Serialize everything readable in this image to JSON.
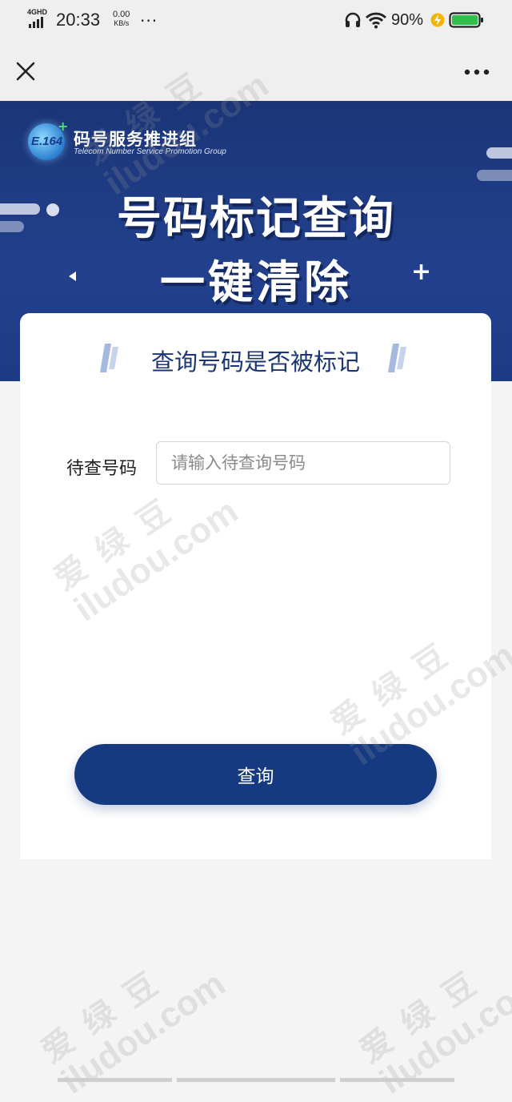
{
  "status_bar": {
    "network": "4GHD",
    "time": "20:33",
    "speed_value": "0.00",
    "speed_unit": "KB/s",
    "more": "···",
    "battery_percent": "90%",
    "battery_color": "#2fbf4a",
    "charging_color": "#f5b400"
  },
  "nav": {
    "close_icon": "close-icon",
    "more_icon": "more-horizontal-icon"
  },
  "banner": {
    "logo_badge": "E.164",
    "org_name": "码号服务推进组",
    "org_name_en": "Telecom Number Service  Promotion Group",
    "title_line1": "号码标记查询",
    "title_line2": "一键清除",
    "bg_color": "#1f3c86"
  },
  "card": {
    "title": "查询号码是否被标记",
    "field_label": "待查号码",
    "input_placeholder": "请输入待查询号码",
    "input_value": "",
    "button_label": "查询",
    "accent_color": "#163a82"
  },
  "watermark": {
    "cn": "爱绿豆",
    "en": "iludou.com"
  }
}
